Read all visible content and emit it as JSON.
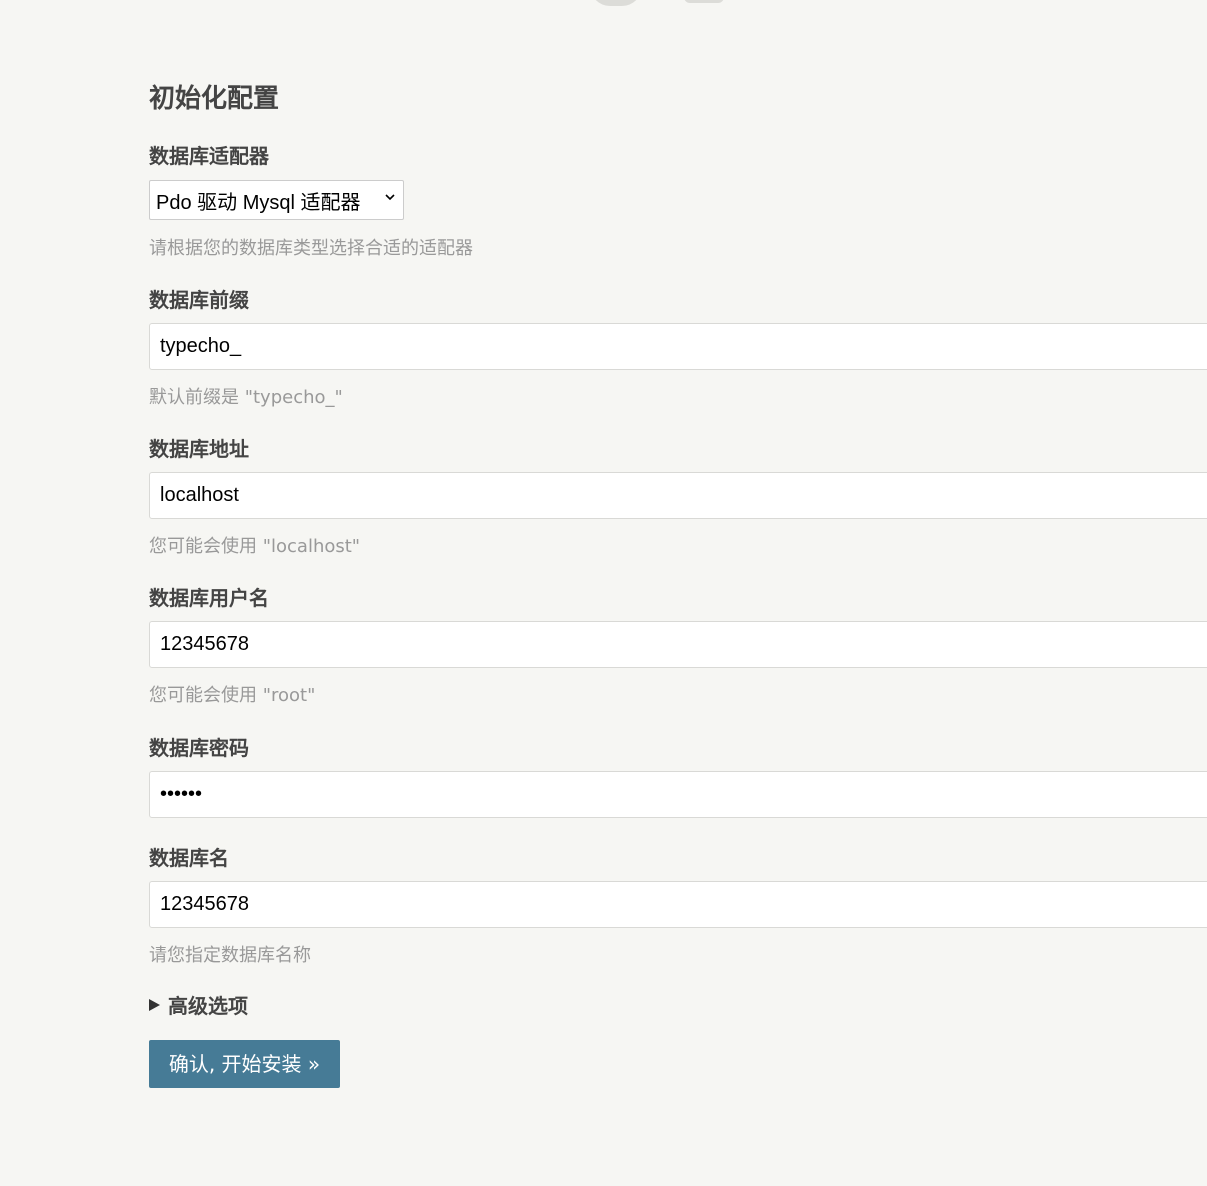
{
  "page": {
    "title": "初始化配置"
  },
  "form": {
    "adapter": {
      "label": "数据库适配器",
      "selected": "Pdo 驱动 Mysql 适配器",
      "hint": "请根据您的数据库类型选择合适的适配器"
    },
    "prefix": {
      "label": "数据库前缀",
      "value": "typecho_",
      "hint": "默认前缀是 \"typecho_\""
    },
    "host": {
      "label": "数据库地址",
      "value": "localhost",
      "hint": "您可能会使用 \"localhost\""
    },
    "user": {
      "label": "数据库用户名",
      "value": "12345678",
      "hint": "您可能会使用 \"root\""
    },
    "password": {
      "label": "数据库密码",
      "value": "••••••"
    },
    "dbname": {
      "label": "数据库名",
      "value": "12345678",
      "hint": "请您指定数据库名称"
    },
    "advanced": {
      "label": "高级选项"
    },
    "submit": {
      "label": "确认, 开始安装 »"
    }
  },
  "colors": {
    "background": "#f6f6f3",
    "button": "#467b96",
    "hint": "#999999",
    "label": "#444444"
  }
}
